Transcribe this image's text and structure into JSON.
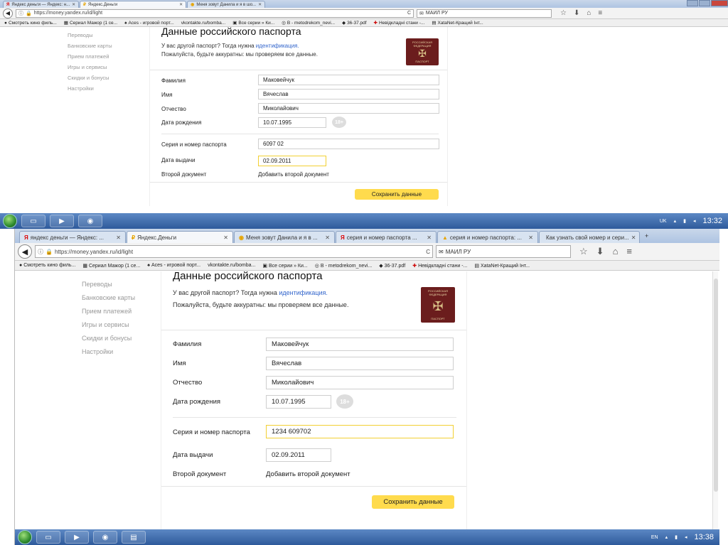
{
  "shot1": {
    "tabs": [
      {
        "fav": "Я",
        "label": "Яндекс деньги — Яндекс: н...",
        "close": "✕"
      },
      {
        "fav": "₽",
        "label": "Яндекс.Деньги",
        "close": "✕"
      },
      {
        "fav": "◉",
        "label": "Меня зовут Данила и я в шо...",
        "close": "✕"
      }
    ],
    "url": "https://money.yandex.ru/id/light",
    "search": "МАИЛ РУ",
    "bookmarks": [
      "Смотреть кино филь...",
      "Сериал Мажор (1 се...",
      "Aces - игровой порт...",
      "vkontakte.ru/bomba...",
      "Все серии » Ки...",
      "В - metodrekom_nevi...",
      "36-37.pdf",
      "Невідкладні стани -...",
      "XataNet-Кращий Інт..."
    ],
    "sidebar": [
      "Переводы",
      "Банковские карты",
      "Прием платежей",
      "Игры и сервисы",
      "Скидки и бонусы",
      "Настройки"
    ],
    "form": {
      "title": "Данные российского паспорта",
      "intro": "У вас другой паспорт? Тогда нужна",
      "intro_link": "идентификация.",
      "note": "Пожалуйста, будьте аккуратны: мы проверяем все данные.",
      "passport_top": "РОССИЙСКАЯ ФЕДЕРАЦИЯ",
      "passport_bottom": "ПАСПОРТ",
      "surname_label": "Фамилия",
      "surname": "Маковейчук",
      "name_label": "Имя",
      "name": "Вячеслав",
      "patronymic_label": "Отчество",
      "patronymic": "Миколайович",
      "dob_label": "Дата рождения",
      "dob": "10.07.1995",
      "badge": "18+",
      "series_label": "Серия и номер паспорта",
      "series": "6097 02",
      "issue_label": "Дата выдачи",
      "issue": "02.09.2011",
      "second_label": "Второй документ",
      "second_link": "Добавить второй документ",
      "save": "Сохранить данные"
    },
    "tray": {
      "lang": "UK",
      "time": "13:32"
    }
  },
  "shot2": {
    "tabs": [
      {
        "fav": "Я",
        "label": "яндекс деньги — Яндекс: ...",
        "close": "✕"
      },
      {
        "fav": "₽",
        "label": "Яндекс.Деньги",
        "close": "✕"
      },
      {
        "fav": "◉",
        "label": "Меня зовут Данила и я в ...",
        "close": "✕"
      },
      {
        "fav": "Я",
        "label": "серия и номер паспорта ...",
        "close": "✕"
      },
      {
        "fav": "▲",
        "label": "серия и номер паспорта: ...",
        "close": "✕"
      },
      {
        "fav": "",
        "label": "Как узнать свой номер и сери...",
        "close": "✕"
      }
    ],
    "url": "https://money.yandex.ru/id/light",
    "search": "МАИЛ РУ",
    "bookmarks": [
      "Смотреть кино филь...",
      "Сериал Мажор (1 се...",
      "Aces - игровой порт...",
      "vkontakte.ru/bomba...",
      "Все серии » Ки...",
      "В - metodrekom_nevi...",
      "36-37.pdf",
      "Невідкладні стани -...",
      "XataNet-Кращий Інт..."
    ],
    "sidebar": [
      "Переводы",
      "Банковские карты",
      "Прием платежей",
      "Игры и сервисы",
      "Скидки и бонусы",
      "Настройки"
    ],
    "form": {
      "title": "Данные российского паспорта",
      "intro": "У вас другой паспорт? Тогда нужна",
      "intro_link": "идентификация.",
      "note": "Пожалуйста, будьте аккуратны: мы проверяем все данные.",
      "passport_top": "РОССИЙСКАЯ ФЕДЕРАЦИЯ",
      "passport_bottom": "ПАСПОРТ",
      "surname_label": "Фамилия",
      "surname": "Маковейчук",
      "name_label": "Имя",
      "name": "Вячеслав",
      "patronymic_label": "Отчество",
      "patronymic": "Миколайович",
      "dob_label": "Дата рождения",
      "dob": "10.07.1995",
      "badge": "18+",
      "series_label": "Серия и номер паспорта",
      "series": "1234 609702",
      "issue_label": "Дата выдачи",
      "issue": "02.09.2011",
      "second_label": "Второй документ",
      "second_link": "Добавить второй документ",
      "save": "Сохранить данные"
    },
    "tray": {
      "lang": "EN",
      "time": "13:38"
    }
  },
  "icons": {
    "back": "◀",
    "info": "ⓘ",
    "lock": "🔒",
    "reload": "C",
    "star": "☆",
    "download": "⬇",
    "home": "⌂",
    "menu": "≡",
    "plus": "+"
  },
  "colors": {
    "accent": "#ffdb4d",
    "link": "#3366cc",
    "focus": "#f2d033"
  }
}
